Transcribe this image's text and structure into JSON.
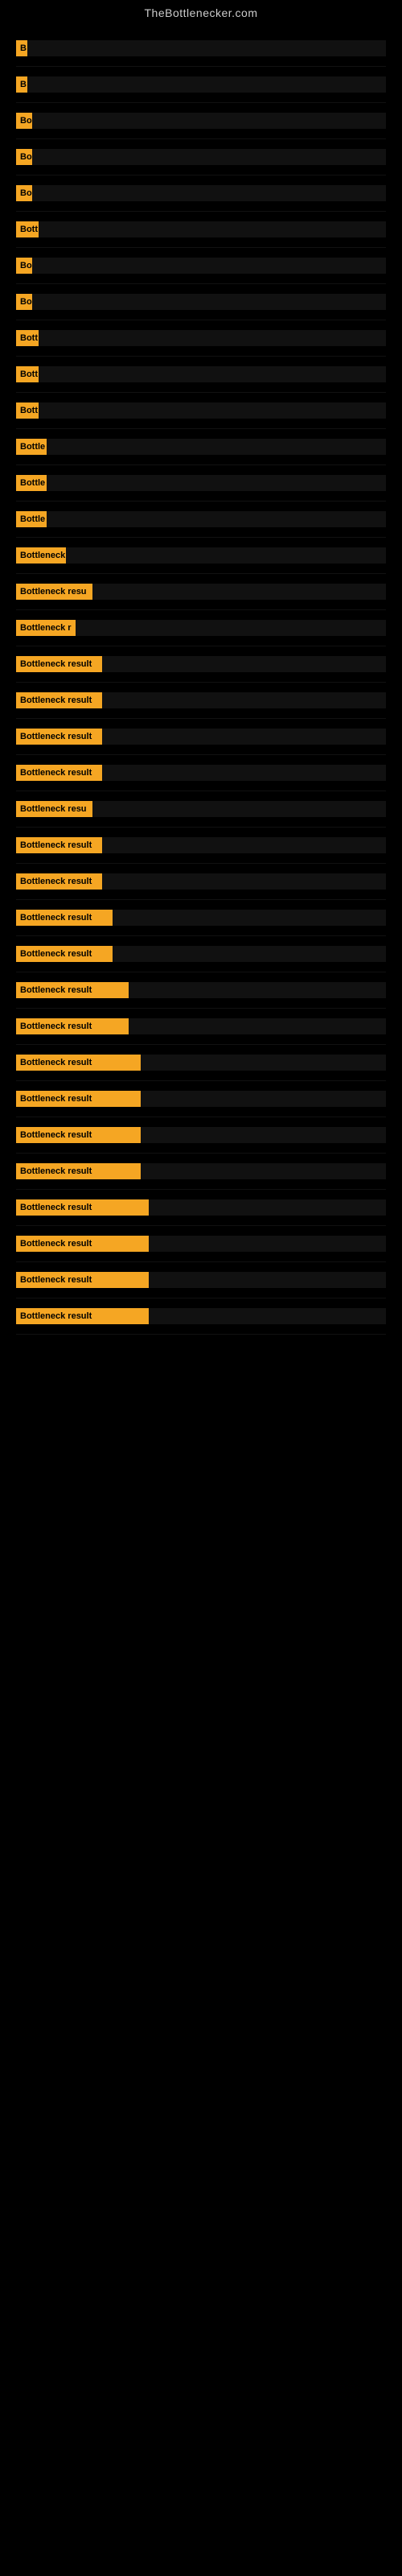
{
  "site_title": "TheBottlenecker.com",
  "rows": [
    {
      "id": 1,
      "label": "B",
      "label_width": 14
    },
    {
      "id": 2,
      "label": "B",
      "label_width": 14
    },
    {
      "id": 3,
      "label": "Bo",
      "label_width": 20
    },
    {
      "id": 4,
      "label": "Bo",
      "label_width": 20
    },
    {
      "id": 5,
      "label": "Bo",
      "label_width": 20
    },
    {
      "id": 6,
      "label": "Bott",
      "label_width": 28
    },
    {
      "id": 7,
      "label": "Bo",
      "label_width": 20
    },
    {
      "id": 8,
      "label": "Bo",
      "label_width": 20
    },
    {
      "id": 9,
      "label": "Bott",
      "label_width": 28
    },
    {
      "id": 10,
      "label": "Bott",
      "label_width": 28
    },
    {
      "id": 11,
      "label": "Bott",
      "label_width": 28
    },
    {
      "id": 12,
      "label": "Bottle",
      "label_width": 38
    },
    {
      "id": 13,
      "label": "Bottle",
      "label_width": 38
    },
    {
      "id": 14,
      "label": "Bottle",
      "label_width": 38
    },
    {
      "id": 15,
      "label": "Bottleneck",
      "label_width": 62
    },
    {
      "id": 16,
      "label": "Bottleneck resu",
      "label_width": 95
    },
    {
      "id": 17,
      "label": "Bottleneck r",
      "label_width": 74
    },
    {
      "id": 18,
      "label": "Bottleneck result",
      "label_width": 107
    },
    {
      "id": 19,
      "label": "Bottleneck result",
      "label_width": 107
    },
    {
      "id": 20,
      "label": "Bottleneck result",
      "label_width": 107
    },
    {
      "id": 21,
      "label": "Bottleneck result",
      "label_width": 107
    },
    {
      "id": 22,
      "label": "Bottleneck resu",
      "label_width": 95
    },
    {
      "id": 23,
      "label": "Bottleneck result",
      "label_width": 107
    },
    {
      "id": 24,
      "label": "Bottleneck result",
      "label_width": 107
    },
    {
      "id": 25,
      "label": "Bottleneck result",
      "label_width": 120
    },
    {
      "id": 26,
      "label": "Bottleneck result",
      "label_width": 120
    },
    {
      "id": 27,
      "label": "Bottleneck result",
      "label_width": 140
    },
    {
      "id": 28,
      "label": "Bottleneck result",
      "label_width": 140
    },
    {
      "id": 29,
      "label": "Bottleneck result",
      "label_width": 155
    },
    {
      "id": 30,
      "label": "Bottleneck result",
      "label_width": 155
    },
    {
      "id": 31,
      "label": "Bottleneck result",
      "label_width": 155
    },
    {
      "id": 32,
      "label": "Bottleneck result",
      "label_width": 155
    },
    {
      "id": 33,
      "label": "Bottleneck result",
      "label_width": 165
    },
    {
      "id": 34,
      "label": "Bottleneck result",
      "label_width": 165
    },
    {
      "id": 35,
      "label": "Bottleneck result",
      "label_width": 165
    },
    {
      "id": 36,
      "label": "Bottleneck result",
      "label_width": 165
    }
  ]
}
